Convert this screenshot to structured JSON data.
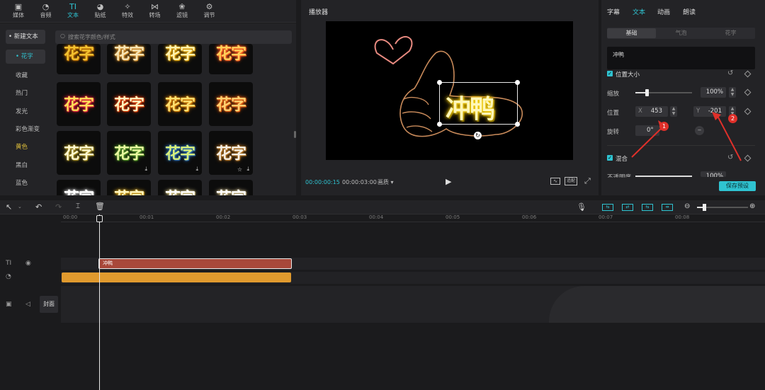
{
  "toolbar": {
    "tools": [
      {
        "icon": "media-icon",
        "glyph": "▣",
        "label": "媒体"
      },
      {
        "icon": "audio-icon",
        "glyph": "◔",
        "label": "音频"
      },
      {
        "icon": "text-icon",
        "glyph": "TI",
        "label": "文本"
      },
      {
        "icon": "sticker-icon",
        "glyph": "◕",
        "label": "贴纸"
      },
      {
        "icon": "effects-icon",
        "glyph": "✧",
        "label": "特效"
      },
      {
        "icon": "transition-icon",
        "glyph": "⋈",
        "label": "转场"
      },
      {
        "icon": "filter-icon",
        "glyph": "❀",
        "label": "滤镜"
      },
      {
        "icon": "adjust-icon",
        "glyph": "⚙",
        "label": "调节"
      }
    ],
    "active_index": 2
  },
  "leftnav": {
    "items": [
      "• 新建文本",
      "• 花字",
      "收藏",
      "热门",
      "发光",
      "彩色渐变",
      "黄色",
      "黑白",
      "蓝色"
    ]
  },
  "search": {
    "placeholder": "搜索花字颜色/样式"
  },
  "grid": {
    "tile_text": "花字",
    "tiles": [
      {
        "color": "#f2c230",
        "glow": "#b86b00"
      },
      {
        "color": "#f7e6b6",
        "glow": "#d6902a"
      },
      {
        "color": "#fff3b0",
        "glow": "#e0a000"
      },
      {
        "color": "#ffd05a",
        "glow": "#ff5a20"
      },
      {
        "color": "#ffde59",
        "glow": "#e01d3a"
      },
      {
        "color": "#fff5c0",
        "glow": "#e03a00"
      },
      {
        "color": "#ffe070",
        "glow": "#d07800"
      },
      {
        "color": "#ffd070",
        "glow": "#e05a10"
      },
      {
        "color": "#fff9d0",
        "glow": "#a08a20"
      },
      {
        "color": "#e8f7a0",
        "glow": "#4a8a20"
      },
      {
        "color": "#d8f07a",
        "glow": "#2a6ab0"
      },
      {
        "color": "#f4efe4",
        "glow": "#b07020"
      },
      {
        "color": "#ffffff",
        "glow": "#bbbbbb"
      },
      {
        "color": "#fff7c0",
        "glow": "#d0a020"
      },
      {
        "color": "#ffffff",
        "glow": "#d0c080"
      },
      {
        "color": "#ffffff",
        "glow": "#c0b080"
      }
    ],
    "download_glyph": "⤓",
    "star_glyph": "☆"
  },
  "player": {
    "title": "播放器",
    "clip_text": "冲鸭",
    "current_time": "00:00:00:15",
    "total_time": "00:00:03:00",
    "quality": "画质 ▾",
    "play_glyph": "▶",
    "btn_ratio": "适配"
  },
  "rpanel": {
    "tabs": [
      "字幕",
      "文本",
      "动画",
      "朗读"
    ],
    "active_tab": 1,
    "subtabs": [
      "基础",
      "气泡",
      "花字"
    ],
    "text_value": "冲鸭",
    "section_position": "位置大小",
    "scale_label": "缩放",
    "scale_value": "100%",
    "scale_level": 0.2,
    "position_label": "位置",
    "x_prefix": "X",
    "x_value": "453",
    "y_prefix": "Y",
    "y_value": "-201",
    "rotate_label": "旋转",
    "rotate_value": "0°",
    "section_blend": "混合",
    "opacity_label": "不透明度",
    "opacity_value": "100%",
    "save_preset": "保存预设",
    "marker1": "1",
    "marker2": "2"
  },
  "timeline": {
    "ticks": [
      "00:00",
      "00:01",
      "00:02",
      "00:03",
      "00:04",
      "00:05",
      "00:06",
      "00:07",
      "00:08"
    ],
    "text_clip_label": "冲鸭",
    "cover_label": "封面"
  }
}
